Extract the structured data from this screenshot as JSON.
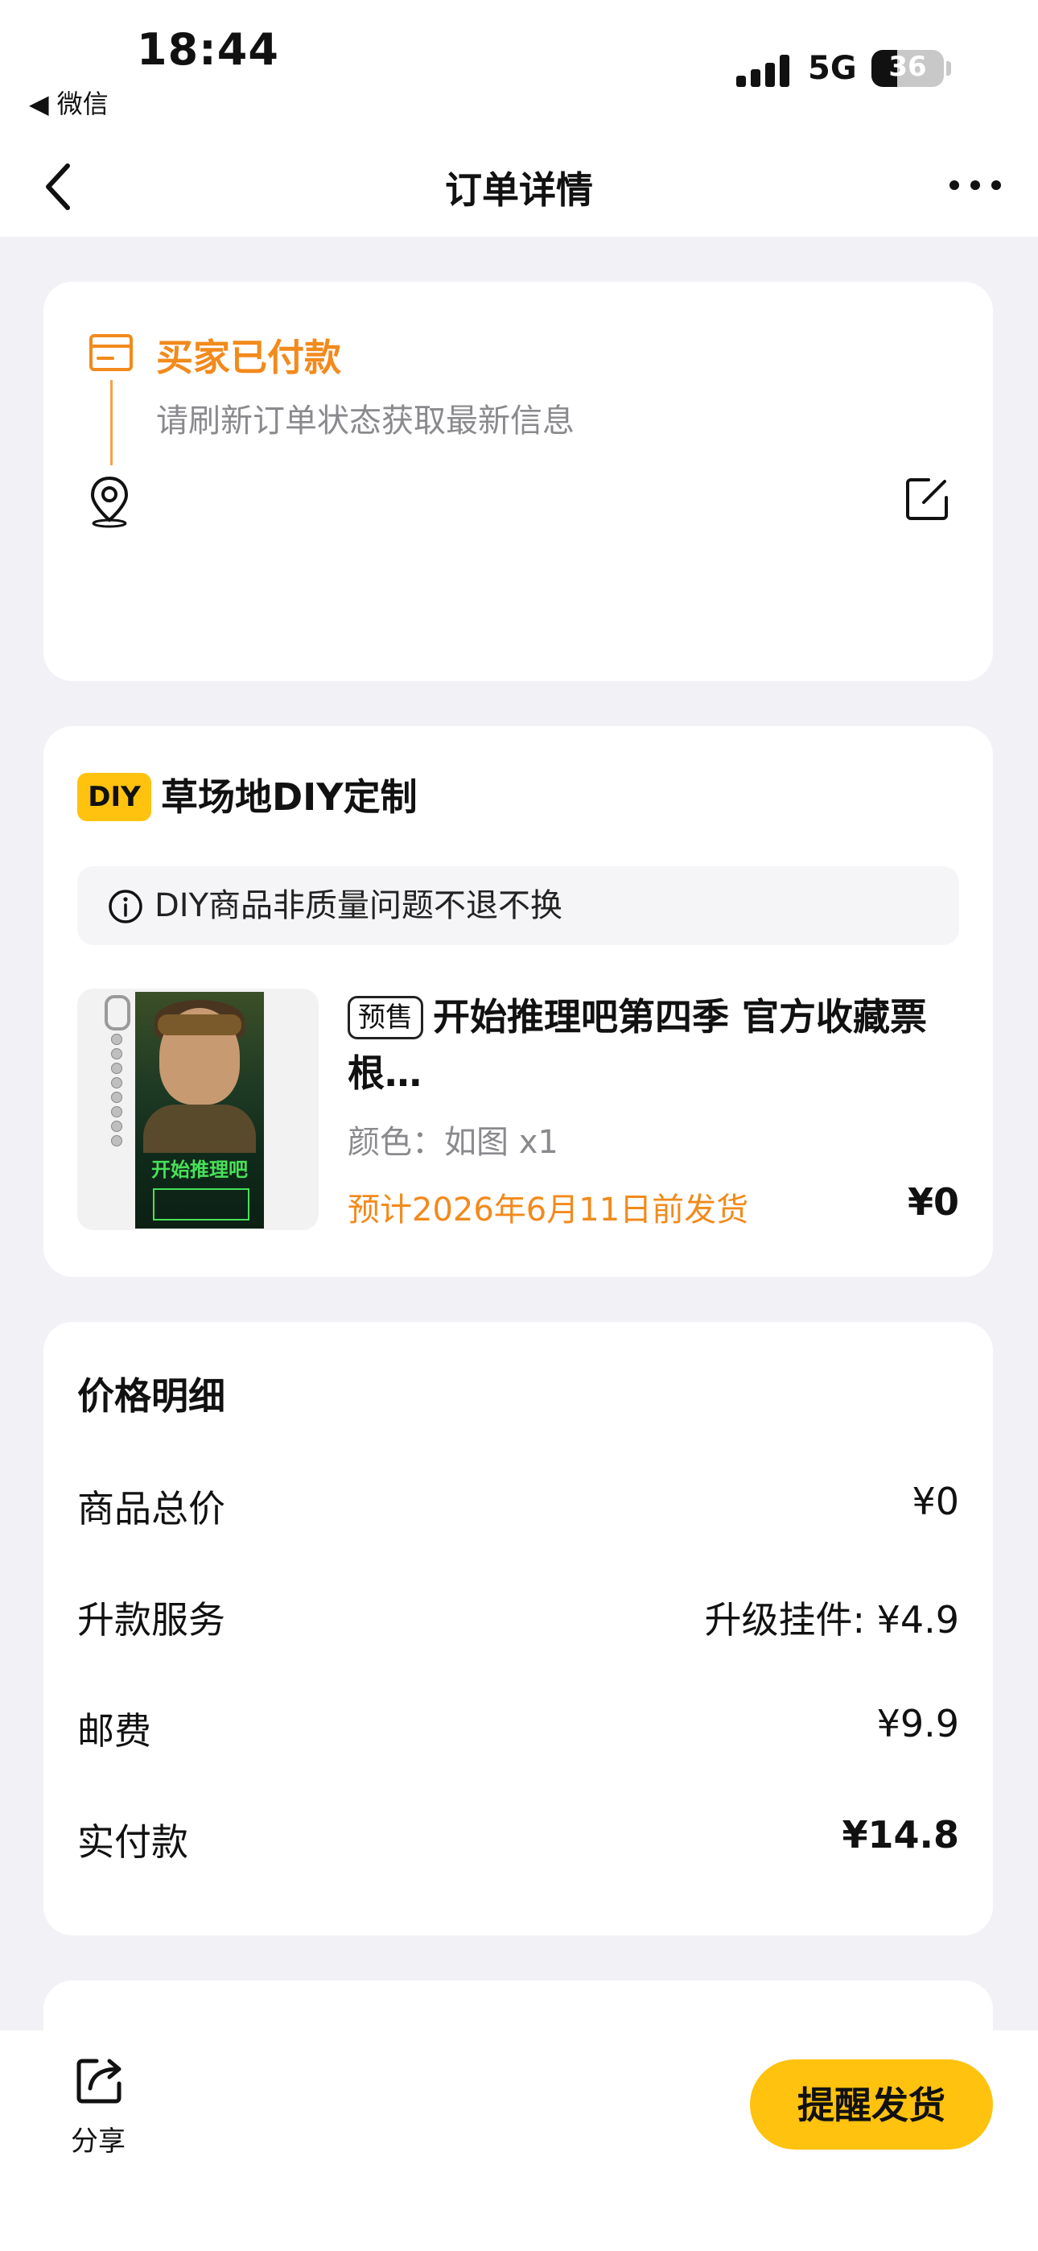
{
  "status_bar": {
    "time": "18:44",
    "back_app": "◀ 微信",
    "network": "5G",
    "battery": "36"
  },
  "nav": {
    "title": "订单详情"
  },
  "order_status": {
    "title": "买家已付款",
    "subtitle": "请刷新订单状态获取最新信息"
  },
  "shop": {
    "badge": "DIY",
    "name": "草场地DIY定制",
    "notice": "DIY商品非质量问题不退不换"
  },
  "product": {
    "tag": "预售",
    "title": "开始推理吧第四季 官方收藏票根…",
    "spec": "颜色：如图 x1",
    "ship_date": "预计2026年6月11日前发货",
    "price": "¥0",
    "image_logo": "开始推理吧"
  },
  "price_detail": {
    "title": "价格明细",
    "rows": [
      {
        "label": "商品总价",
        "value": "¥0"
      },
      {
        "label": "升款服务",
        "value": "升级挂件: ¥4.9"
      },
      {
        "label": "邮费",
        "value": "¥9.9"
      },
      {
        "label": "实付款",
        "value": "¥14.8"
      }
    ]
  },
  "bottom": {
    "share_label": "分享",
    "remind_button": "提醒发货"
  },
  "colors": {
    "accent_orange": "#f28a1c",
    "accent_yellow": "#ffc20e",
    "page_bg": "#f2f2f6"
  }
}
